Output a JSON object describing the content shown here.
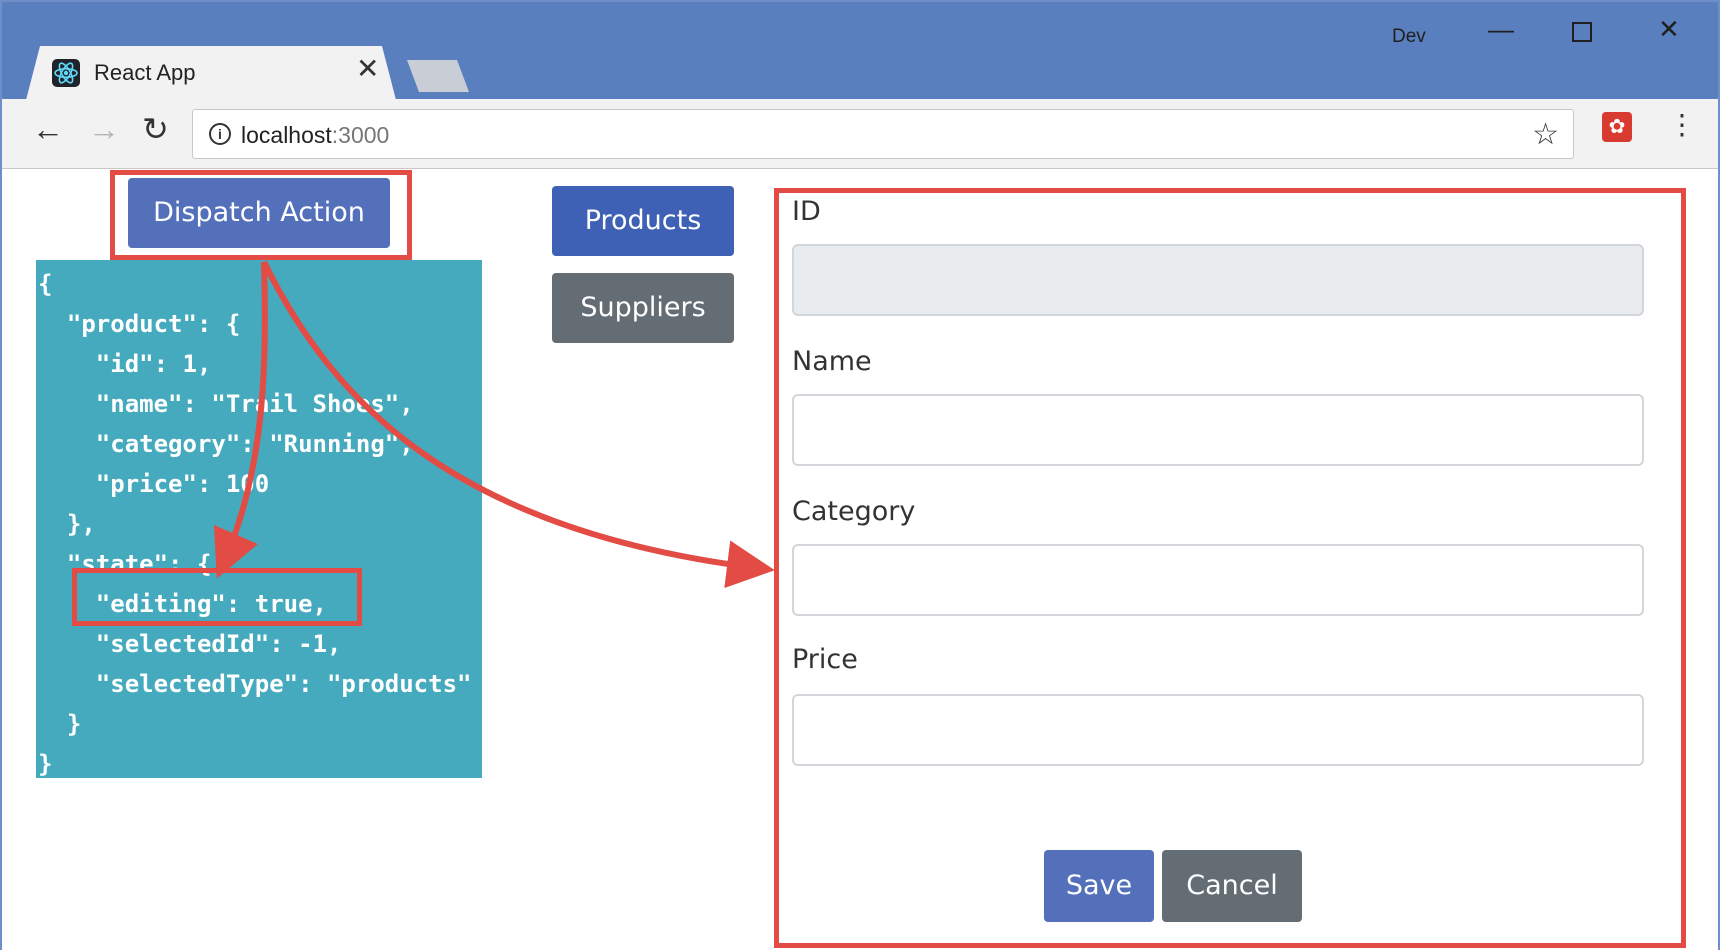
{
  "browser": {
    "tab_title": "React App",
    "tab_close": "✕",
    "profile": "Dev",
    "window_controls": {
      "minimize": "—",
      "close": "✕"
    },
    "nav": {
      "back": "←",
      "forward": "→",
      "reload": "↻"
    },
    "url_host": "localhost",
    "url_port": ":3000",
    "info": "i",
    "bookmark": "☆",
    "menu": "⋮",
    "icons": [
      "react-icon",
      "info-icon",
      "star-icon",
      "extension-icon",
      "menu-icon"
    ]
  },
  "page": {
    "dispatch_label": "Dispatch Action",
    "nav_buttons": [
      "Products",
      "Suppliers"
    ],
    "json_lines": [
      "{",
      "  \"product\": {",
      "    \"id\": 1,",
      "    \"name\": \"Trail Shoes\",",
      "    \"category\": \"Running\",",
      "    \"price\": 100",
      "  },",
      "  \"state\": {",
      "    \"editing\": true,",
      "    \"selectedId\": -1,",
      "    \"selectedType\": \"products\"",
      "  }",
      "}"
    ],
    "form": {
      "fields": [
        {
          "label": "ID",
          "value": ""
        },
        {
          "label": "Name",
          "value": ""
        },
        {
          "label": "Category",
          "value": ""
        },
        {
          "label": "Price",
          "value": ""
        }
      ],
      "save_label": "Save",
      "cancel_label": "Cancel"
    }
  },
  "colors": {
    "titlebar": "#5a7fbe",
    "primary": "#5470bb",
    "secondary": "#646d74",
    "json_bg": "#45aabd",
    "highlight": "#e34b45"
  }
}
